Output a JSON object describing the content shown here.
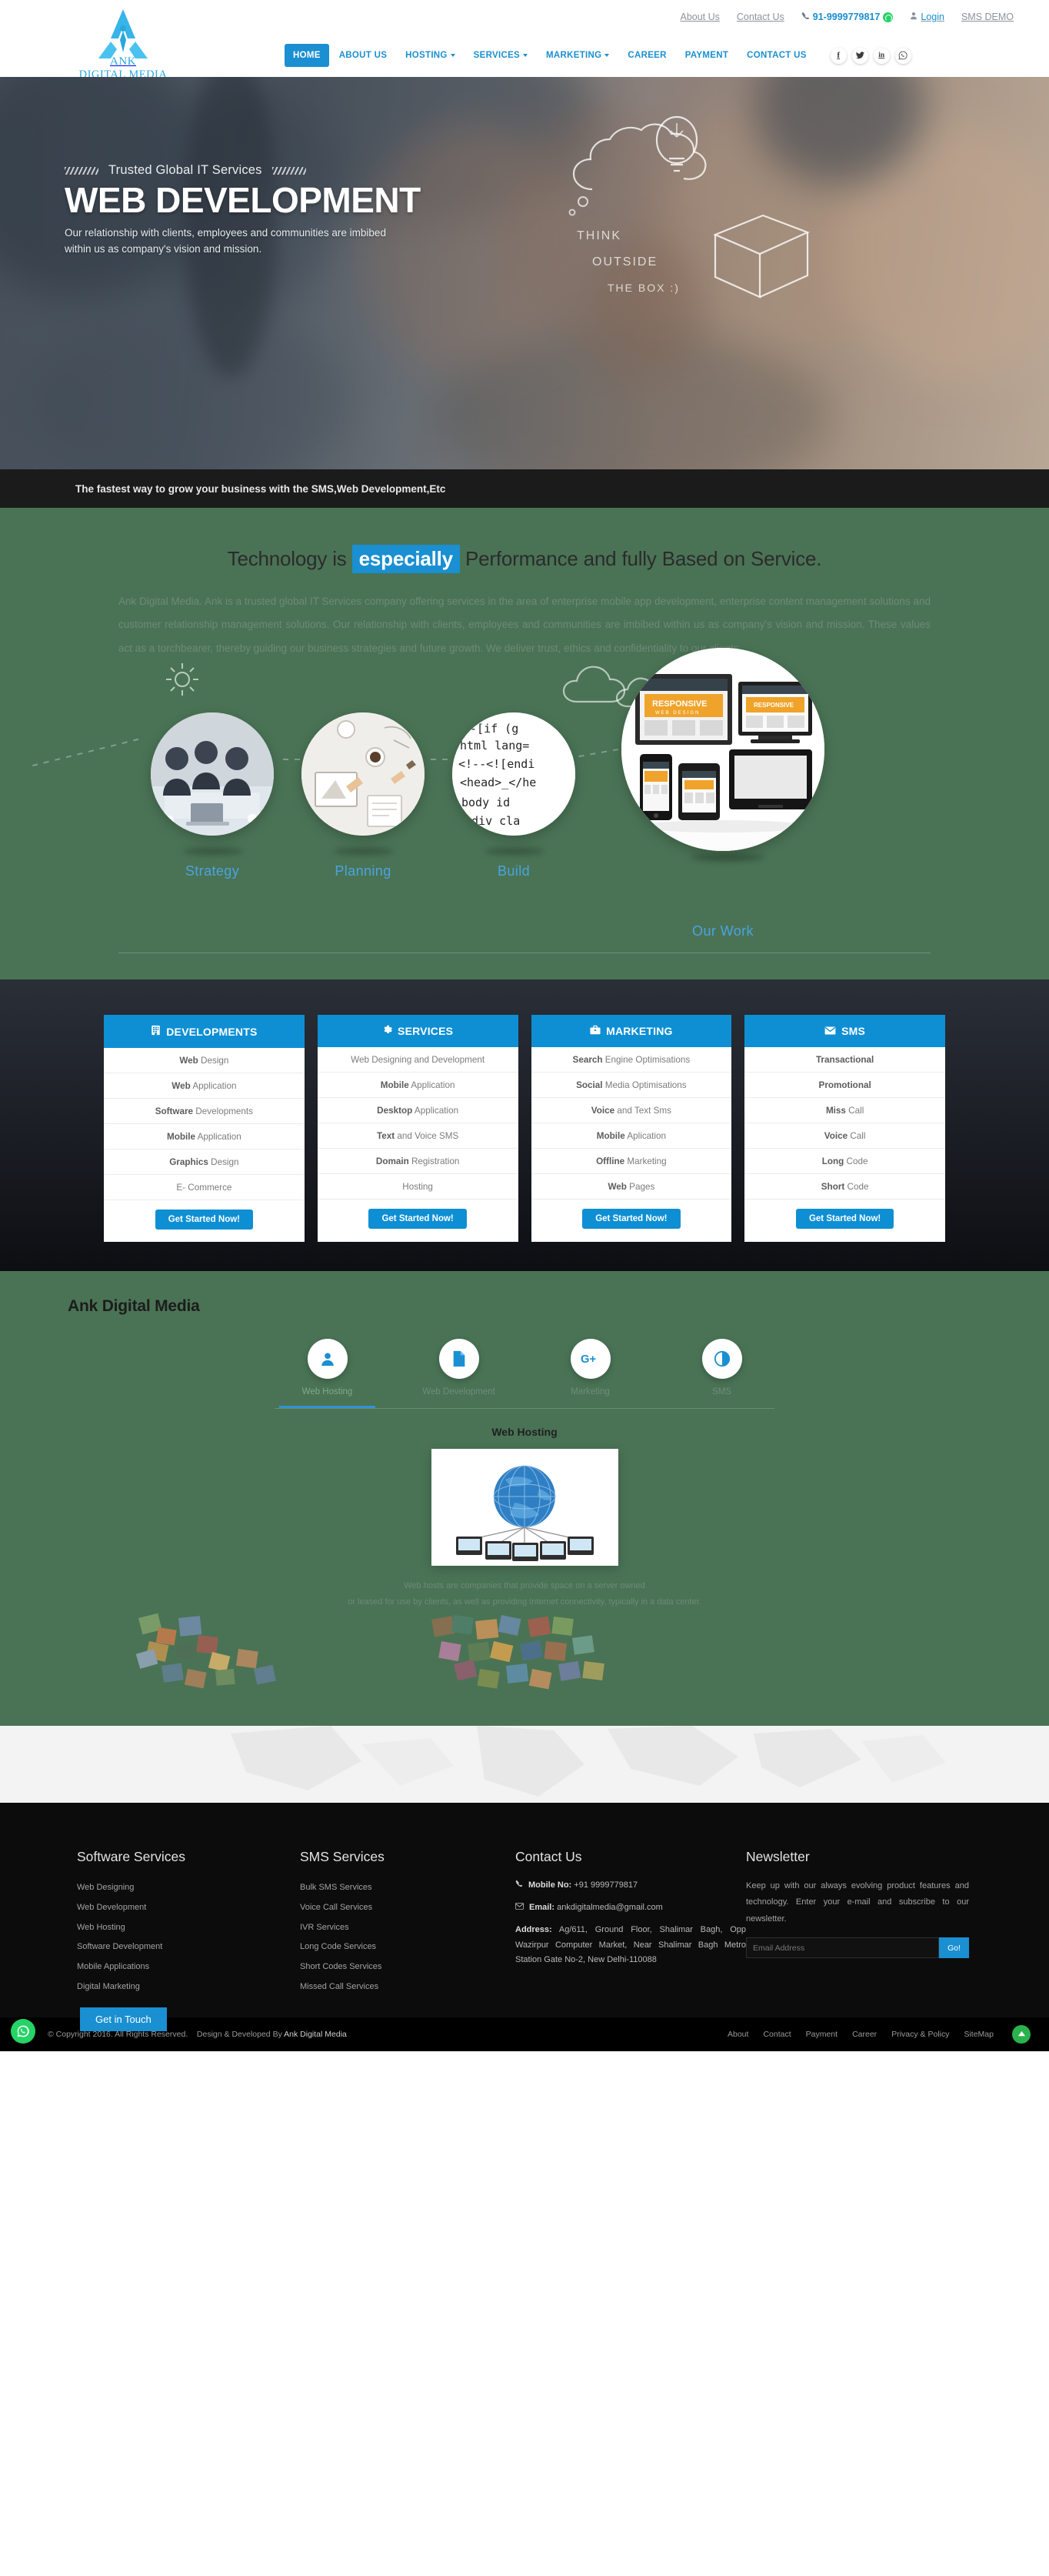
{
  "topbar": {
    "about": "About Us",
    "contact": "Contact Us",
    "phone": "91-9999779817",
    "whatsapp_icon": "whatsapp-icon",
    "login": "Login",
    "sms_demo": "SMS DEMO"
  },
  "logo": {
    "line1": "ANK",
    "line2": "DIGITAL MEDIA"
  },
  "nav": {
    "items": [
      {
        "label": "HOME",
        "active": true,
        "caret": false
      },
      {
        "label": "ABOUT US",
        "active": false,
        "caret": false
      },
      {
        "label": "HOSTING",
        "active": false,
        "caret": true
      },
      {
        "label": "SERVICES",
        "active": false,
        "caret": true
      },
      {
        "label": "MARKETING",
        "active": false,
        "caret": true
      },
      {
        "label": "CAREER",
        "active": false,
        "caret": false
      },
      {
        "label": "PAYMENT",
        "active": false,
        "caret": false
      },
      {
        "label": "CONTACT US",
        "active": false,
        "caret": false
      }
    ],
    "socials": [
      "facebook-icon",
      "twitter-icon",
      "linkedin-icon",
      "whatsapp-icon"
    ]
  },
  "hero": {
    "eyebrow": "Trusted Global IT Services",
    "title": "WEB DEVELOPMENT",
    "subtitle": "Our relationship with clients, employees and communities are imbibed within us as company's vision and mission.",
    "doodle_line1": "THINK",
    "doodle_line2": "OUTSIDE",
    "doodle_line3": "THE BOX :)"
  },
  "strip": {
    "text": "The fastest way to grow your business with the SMS,Web Development,Etc"
  },
  "about": {
    "heading_pre": "Technology is",
    "heading_hl": "especially",
    "heading_post": "Performance and fully Based on Service.",
    "paragraph": "Ank Digital Media. Ank is a trusted global IT Services company offering services in the area of enterprise mobile app development, enterprise content management solutions and customer relationship management solutions. Our relationship with clients, employees and communities are imbibed within us as company's vision and mission. These values act as a torchbearer, thereby guiding our business strategies and future growth. We deliver trust, ethics and confidentiality to our clients.",
    "steps": [
      {
        "label": "Strategy"
      },
      {
        "label": "Planning"
      },
      {
        "label": "Build"
      },
      {
        "label": "Our Work"
      }
    ]
  },
  "pricing": {
    "columns": [
      {
        "title": "DEVELOPMENTS",
        "icon": "building-icon",
        "rows": [
          {
            "b": "Web",
            "t": " Design"
          },
          {
            "b": "Web",
            "t": " Application"
          },
          {
            "b": "Software",
            "t": " Developments"
          },
          {
            "b": "Mobile",
            "t": " Application"
          },
          {
            "b": "Graphics",
            "t": " Design"
          },
          {
            "b": "",
            "t": "E- Commerce"
          }
        ],
        "button": "Get Started Now!"
      },
      {
        "title": "SERVICES",
        "icon": "gear-icon",
        "rows": [
          {
            "b": "",
            "t": "Web Designing and Development"
          },
          {
            "b": "Mobile",
            "t": " Application"
          },
          {
            "b": "Desktop",
            "t": " Application"
          },
          {
            "b": "Text",
            "t": " and Voice SMS"
          },
          {
            "b": "Domain",
            "t": " Registration"
          },
          {
            "b": "",
            "t": "Hosting"
          }
        ],
        "button": "Get Started Now!"
      },
      {
        "title": "MARKETING",
        "icon": "briefcase-icon",
        "rows": [
          {
            "b": "Search",
            "t": " Engine Optimisations"
          },
          {
            "b": "Social",
            "t": " Media Optimisations"
          },
          {
            "b": "Voice",
            "t": " and Text Sms"
          },
          {
            "b": "Mobile",
            "t": " Aplication"
          },
          {
            "b": "Offline",
            "t": " Marketing"
          },
          {
            "b": "Web",
            "t": " Pages"
          }
        ],
        "button": "Get Started Now!"
      },
      {
        "title": "SMS",
        "icon": "envelope-icon",
        "rows": [
          {
            "b": "Transactional",
            "t": ""
          },
          {
            "b": "Promotional",
            "t": ""
          },
          {
            "b": "Miss",
            "t": " Call"
          },
          {
            "b": "Voice",
            "t": " Call"
          },
          {
            "b": "Long",
            "t": " Code"
          },
          {
            "b": "Short",
            "t": " Code"
          }
        ],
        "button": "Get Started Now!"
      }
    ]
  },
  "services_tabs": {
    "section_title": "Ank Digital Media",
    "tabs": [
      {
        "label": "Web Hosting",
        "icon": "user-icon",
        "active": true
      },
      {
        "label": "Web Development",
        "icon": "document-icon",
        "active": false
      },
      {
        "label": "Marketing",
        "icon": "google-plus-icon",
        "active": false
      },
      {
        "label": "SMS",
        "icon": "contrast-icon",
        "active": false
      }
    ],
    "panel_title": "Web Hosting",
    "panel_image": "globe-servers-image",
    "panel_caption_line1": "Web hosts are companies that provide space on a server owned",
    "panel_caption_line2": "or leased for use by clients, as well as providing Internet connectivity, typically in a data center."
  },
  "footer": {
    "get_in_touch": "Get in Touch",
    "software_services": {
      "title": "Software Services",
      "links": [
        "Web Designing",
        "Web Development",
        "Web Hosting",
        "Software Development",
        "Mobile Applications",
        "Digital Marketing"
      ]
    },
    "sms_services": {
      "title": "SMS Services",
      "links": [
        "Bulk SMS Services",
        "Voice Call Services",
        "IVR Services",
        "Long Code Services",
        "Short Codes Services",
        "Missed Call Services"
      ]
    },
    "contact": {
      "title": "Contact Us",
      "mobile_label": "Mobile No:",
      "mobile_value": " +91 9999779817",
      "email_label": "Email:",
      "email_value": " ankdigitalmedia@gmail.com",
      "address_label": "Address:",
      "address_value": " Ag/611, Ground Floor, Shalimar Bagh, Opp Wazirpur Computer Market, Near Shalimar Bagh Metro Station Gate No-2, New Delhi-110088"
    },
    "newsletter": {
      "title": "Newsletter",
      "text": "Keep up with our always evolving product features and technology. Enter your e-mail and subscribe to our newsletter.",
      "placeholder": "Email Address",
      "button": "Go!"
    }
  },
  "copyright": {
    "text": "© Copyright 2016. All Rights Reserved.",
    "credit_pre": "Design & Developed By",
    "credit": " Ank Digital Media",
    "links": [
      "About",
      "Contact",
      "Payment",
      "Career",
      "Privacy & Policy",
      "SiteMap"
    ]
  },
  "colors": {
    "accent_blue": "#1a8fd1",
    "panel_blue": "#0e8fd4",
    "green_bg": "#4a7355",
    "dark_bg": "#15171c",
    "footer_bg": "#0c0c0c",
    "whatsapp_green": "#25d366"
  }
}
